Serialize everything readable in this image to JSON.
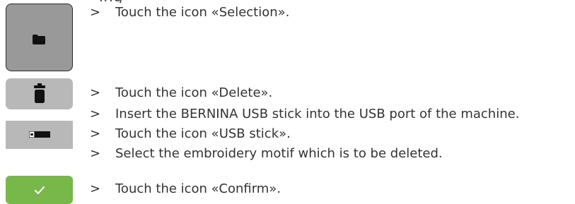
{
  "steps": [
    {
      "marker": ">",
      "text": "Touch the icon «Selection»."
    },
    {
      "marker": ">",
      "text": "Touch the icon «Delete»."
    },
    {
      "marker": ">",
      "text": "Insert the BERNINA USB stick into the USB port of the machine."
    },
    {
      "marker": ">",
      "text": "Touch the icon «USB stick»."
    },
    {
      "marker": ">",
      "text": "Select the embroidery motif which is to be deleted."
    },
    {
      "marker": ">",
      "text": "Touch the icon «Confirm»."
    }
  ],
  "icons": {
    "selection": "folder-icon",
    "delete": "trash-icon",
    "usb_stick": "usb-stick-icon",
    "confirm": "checkmark-icon"
  },
  "colors": {
    "selection_button": "#999999",
    "delete_button": "#b8b8b8",
    "usb_button": "#b8b8b8",
    "confirm_button": "#78b84a",
    "text": "#333333"
  }
}
